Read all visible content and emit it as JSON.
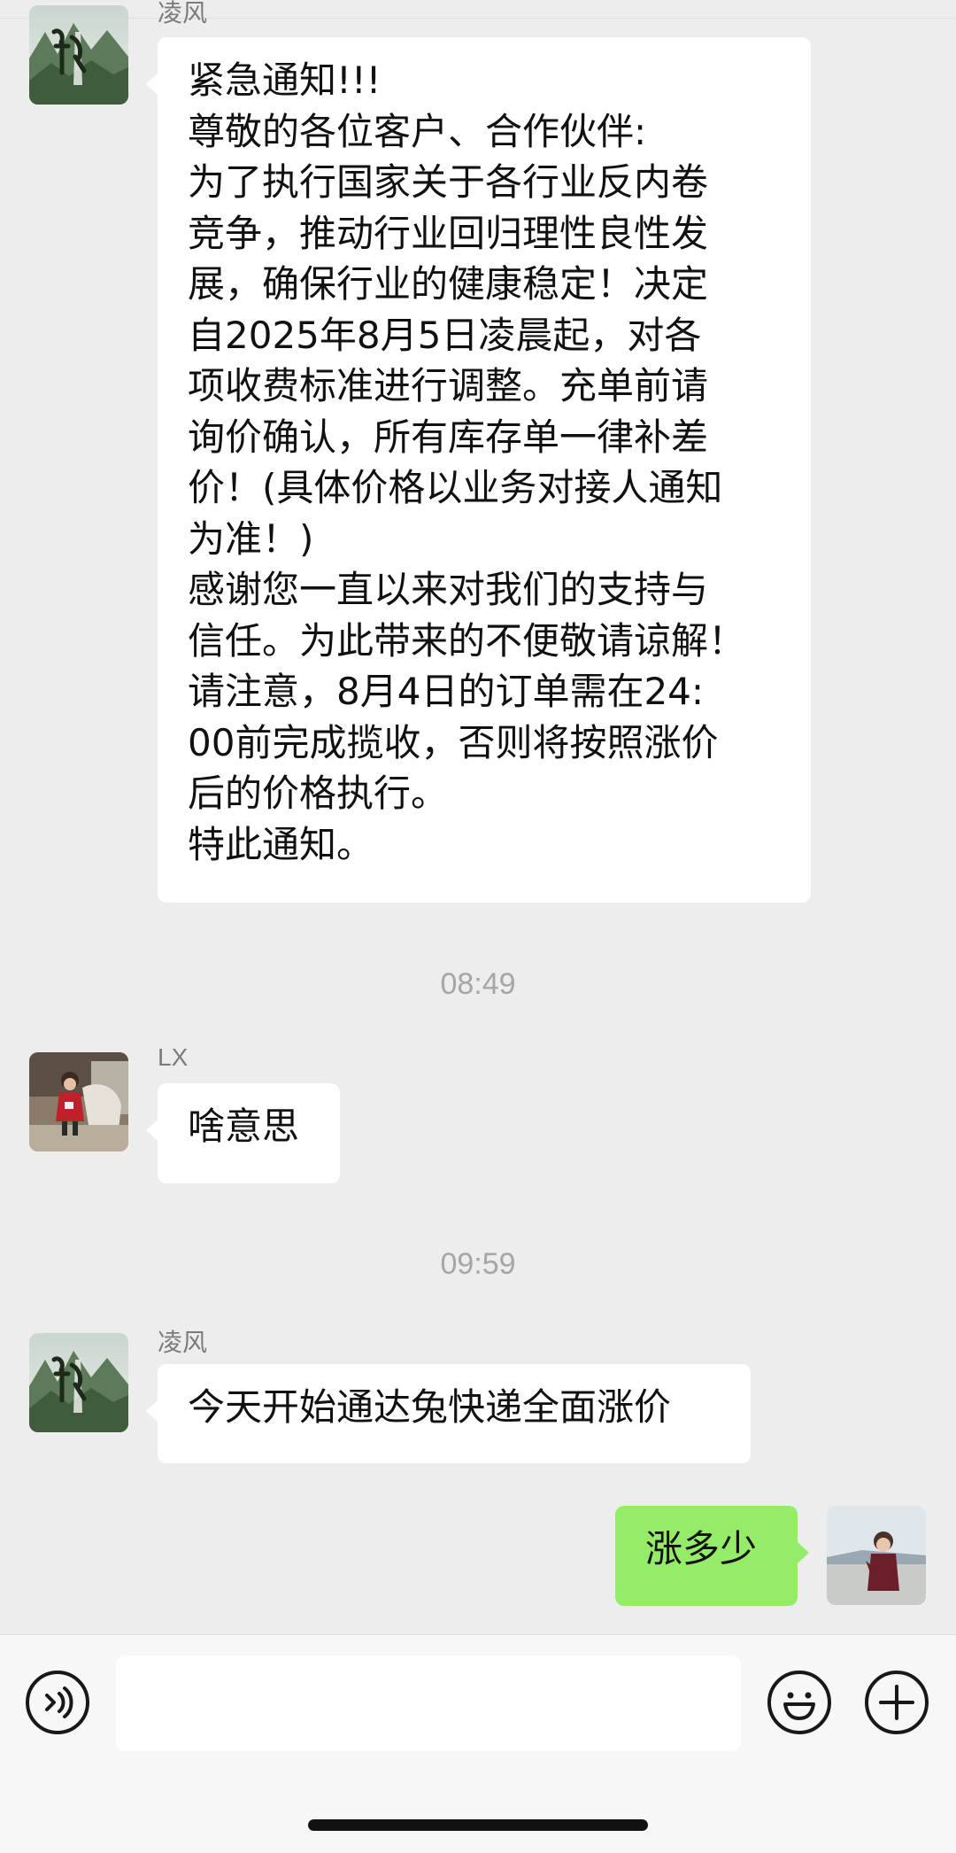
{
  "messages": [
    {
      "sender": "凌风",
      "avatar_icon": "chen-landscape-avatar",
      "lines": [
        "紧急通知!!!",
        "尊敬的各位客户、合作伙伴:",
        "为了执行国家关于各行业反内卷",
        "竞争，推动行业回归理性良性发",
        "展，确保行业的健康稳定！决定",
        "自2025年8月5日凌晨起，对各",
        "项收费标准进行调整。充单前请",
        "询价确认，所有库存单一律补差",
        "价！(具体价格以业务对接人通知",
        "为准！)",
        "感谢您一直以来对我们的支持与",
        "信任。为此带来的不便敬请谅解！",
        "请注意，8月4日的订单需在24:",
        "00前完成揽收，否则将按照涨价",
        "后的价格执行。",
        "特此通知。"
      ]
    },
    {
      "timestamp": "08:49"
    },
    {
      "sender": "LX",
      "avatar_icon": "child-photo-avatar",
      "text": "啥意思"
    },
    {
      "timestamp": "09:59"
    },
    {
      "sender": "凌风",
      "avatar_icon": "chen-landscape-avatar",
      "text": "今天开始通达兔快递全面涨价"
    },
    {
      "sender": "self",
      "avatar_icon": "self-photo-avatar",
      "text": "涨多少"
    }
  ],
  "input_bar": {
    "voice_icon": "voice-icon",
    "emoji_icon": "emoji-icon",
    "plus_icon": "plus-icon",
    "message_value": ""
  },
  "colors": {
    "background": "#ededed",
    "bubble_other": "#ffffff",
    "bubble_self": "#95ec69",
    "timestamp": "#a6a6a6"
  }
}
